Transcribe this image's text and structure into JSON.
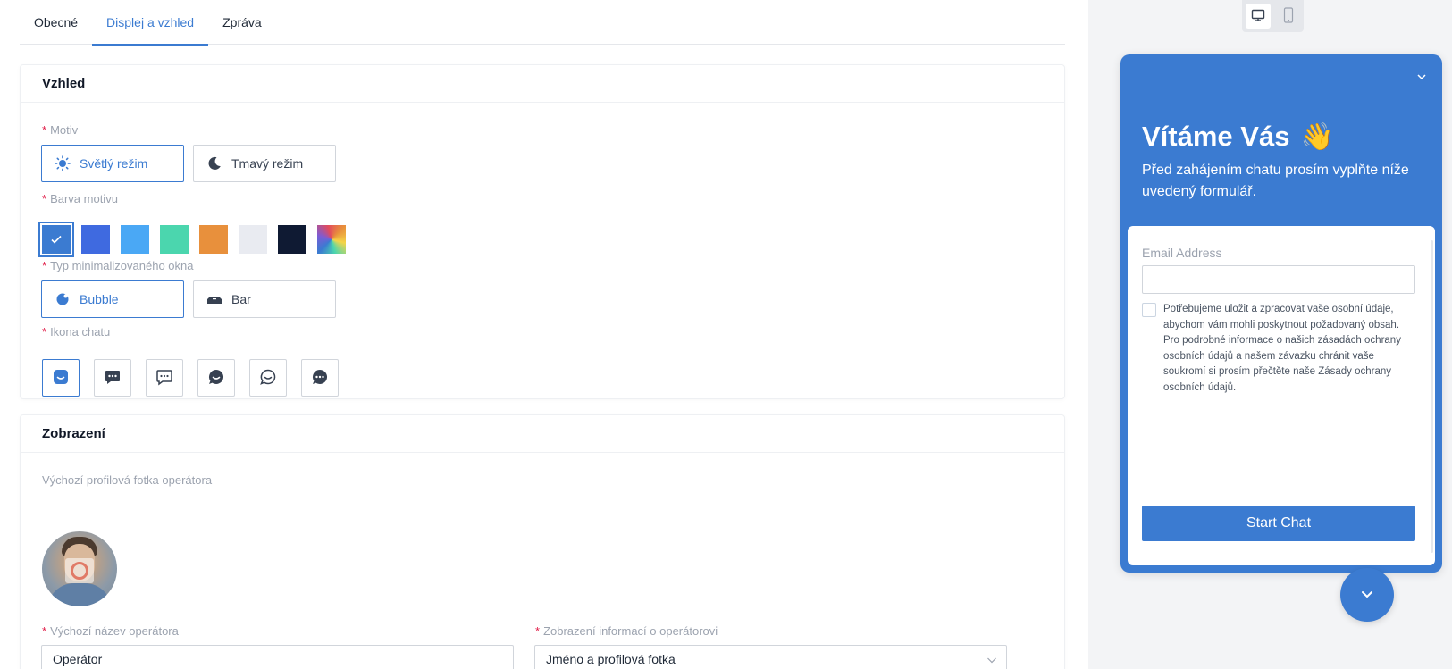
{
  "tabs": [
    {
      "label": "Obecné",
      "active": false
    },
    {
      "label": "Displej a vzhled",
      "active": true
    },
    {
      "label": "Zpráva",
      "active": false
    }
  ],
  "appearance": {
    "title": "Vzhled",
    "theme_label": "Motiv",
    "theme_options": [
      {
        "label": "Světlý režim",
        "icon": "sun-icon",
        "selected": true
      },
      {
        "label": "Tmavý režim",
        "icon": "moon-icon",
        "selected": false
      }
    ],
    "color_label": "Barva motivu",
    "colors": [
      "#3b7bd1",
      "#3f6ae0",
      "#4aa8f5",
      "#4bd6ae",
      "#e8903c",
      "#e9ebf1",
      "#0f1a33",
      "gradient"
    ],
    "selected_color_index": 0,
    "minimized_label": "Typ minimalizovaného okna",
    "minimized_options": [
      {
        "label": "Bubble",
        "icon": "bubble-icon",
        "selected": true
      },
      {
        "label": "Bar",
        "icon": "bar-icon",
        "selected": false
      }
    ],
    "chat_icon_label": "Ikona chatu",
    "chat_icons": [
      "chat-smile-square-icon",
      "chat-dots-square-filled-icon",
      "chat-dots-square-outline-icon",
      "chat-smile-round-filled-icon",
      "chat-smile-round-outline-icon",
      "chat-dots-round-filled-icon"
    ],
    "selected_chat_icon_index": 0
  },
  "display": {
    "title": "Zobrazení",
    "avatar_label": "Výchozí profilová fotka operátora",
    "operator_name_label": "Výchozí název operátora",
    "operator_name_value": "Operátor",
    "operator_info_label": "Zobrazení informací o operátorovi",
    "operator_info_value": "Jméno a profilová fotka"
  },
  "preview": {
    "title": "Vítáme Vás",
    "wave_emoji": "👋",
    "subtitle": "Před zahájením chatu prosím vyplňte níže uvedený formulář.",
    "email_label": "Email Address",
    "consent_text": "Potřebujeme uložit a zpracovat vaše osobní údaje, abychom vám mohli poskytnout požadovaný obsah. Pro podrobné informace o našich zásadách ochrany osobních údajů a našem závazku chránit vaše soukromí si prosím přečtěte naše Zásady ochrany osobních údajů.",
    "start_button": "Start Chat",
    "accent_color": "#3b7bd1"
  }
}
